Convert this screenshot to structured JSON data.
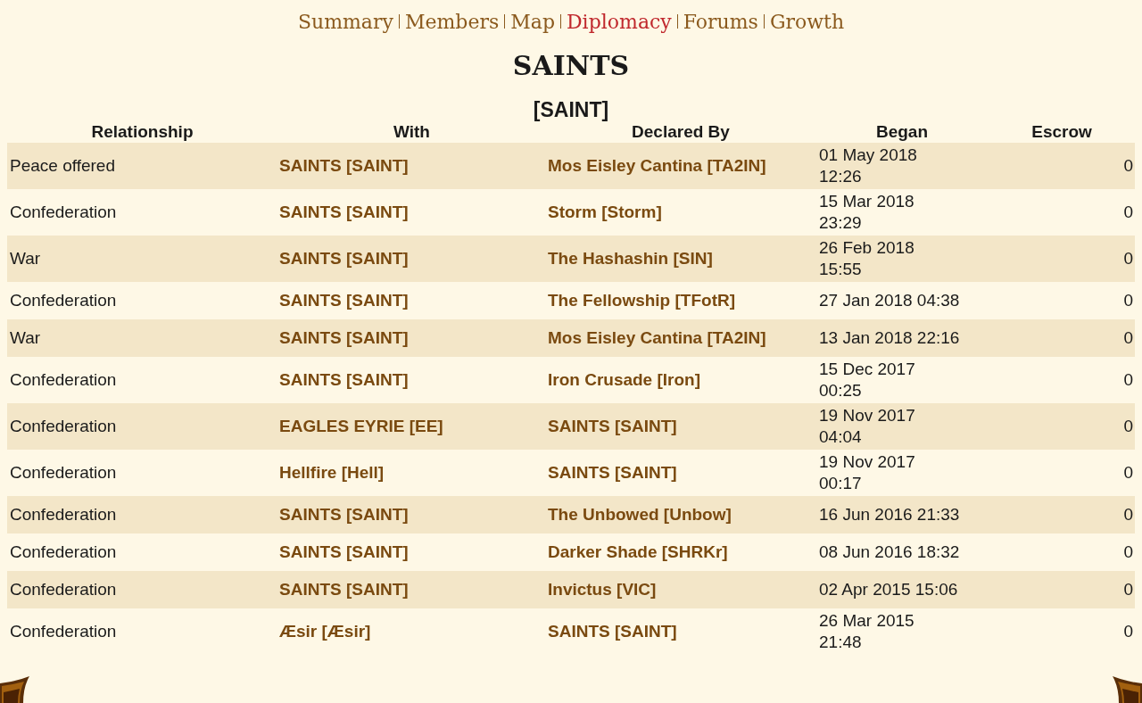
{
  "nav": [
    {
      "label": "Summary",
      "selected": false
    },
    {
      "label": "Members",
      "selected": false
    },
    {
      "label": "Map",
      "selected": false
    },
    {
      "label": "Diplomacy",
      "selected": true
    },
    {
      "label": "Forums",
      "selected": false
    },
    {
      "label": "Growth",
      "selected": false
    }
  ],
  "title": "SAINTS",
  "tag": "[SAINT]",
  "table": {
    "columns": [
      "Relationship",
      "With",
      "Declared By",
      "Began",
      "Escrow"
    ],
    "rows": [
      {
        "relationship": "Peace offered",
        "with": "SAINTS [SAINT]",
        "declared_by": "Mos Eisley Cantina [TA2IN]",
        "began": "01 May 2018\n12:26",
        "escrow": "0"
      },
      {
        "relationship": "Confederation",
        "with": "SAINTS [SAINT]",
        "declared_by": "Storm [Storm]",
        "began": "15 Mar 2018\n23:29",
        "escrow": "0"
      },
      {
        "relationship": "War",
        "with": "SAINTS [SAINT]",
        "declared_by": "The Hashashin [SIN]",
        "began": "26 Feb 2018\n15:55",
        "escrow": "0"
      },
      {
        "relationship": "Confederation",
        "with": "SAINTS [SAINT]",
        "declared_by": "The Fellowship [TFotR]",
        "began": "27 Jan 2018 04:38",
        "escrow": "0"
      },
      {
        "relationship": "War",
        "with": "SAINTS [SAINT]",
        "declared_by": "Mos Eisley Cantina [TA2IN]",
        "began": "13 Jan 2018 22:16",
        "escrow": "0"
      },
      {
        "relationship": "Confederation",
        "with": "SAINTS [SAINT]",
        "declared_by": "Iron Crusade [Iron]",
        "began": "15 Dec 2017\n00:25",
        "escrow": "0"
      },
      {
        "relationship": "Confederation",
        "with": "EAGLES EYRIE [EE]",
        "declared_by": "SAINTS [SAINT]",
        "began": "19 Nov 2017\n04:04",
        "escrow": "0"
      },
      {
        "relationship": "Confederation",
        "with": "Hellfire [Hell]",
        "declared_by": "SAINTS [SAINT]",
        "began": "19 Nov 2017\n00:17",
        "escrow": "0"
      },
      {
        "relationship": "Confederation",
        "with": "SAINTS [SAINT]",
        "declared_by": "The Unbowed [Unbow]",
        "began": "16 Jun 2016 21:33",
        "escrow": "0"
      },
      {
        "relationship": "Confederation",
        "with": "SAINTS [SAINT]",
        "declared_by": "Darker Shade [SHRKr]",
        "began": "08 Jun 2016 18:32",
        "escrow": "0"
      },
      {
        "relationship": "Confederation",
        "with": "SAINTS [SAINT]",
        "declared_by": "Invictus [VIC]",
        "began": "02 Apr 2015 15:06",
        "escrow": "0"
      },
      {
        "relationship": "Confederation",
        "with": "Æsir [Æsir]",
        "declared_by": "SAINTS [SAINT]",
        "began": "26 Mar 2015\n21:48",
        "escrow": "0"
      }
    ]
  }
}
